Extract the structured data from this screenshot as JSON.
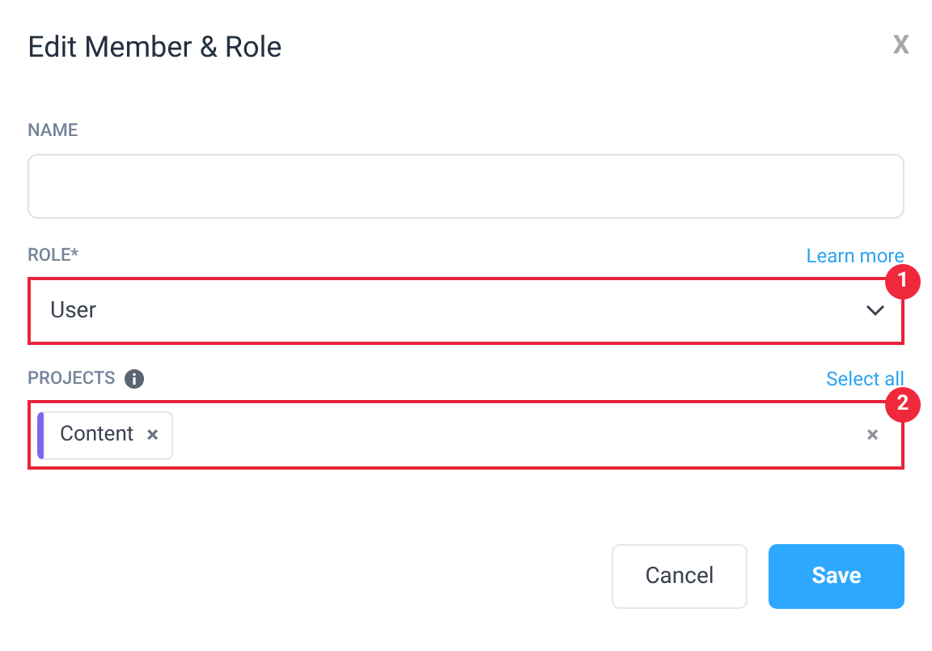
{
  "dialog": {
    "title": "Edit Member & Role",
    "close": "X"
  },
  "name_field": {
    "label": "NAME"
  },
  "role_field": {
    "label": "ROLE*",
    "link": "Learn more",
    "value": "User",
    "annotation": "1"
  },
  "projects_field": {
    "label": "PROJECTS",
    "link": "Select all",
    "annotation": "2",
    "tags": [
      {
        "label": "Content",
        "remove": "×",
        "color": "#7b68ee"
      }
    ],
    "clear": "×"
  },
  "buttons": [
    {
      "label": "Cancel",
      "kind": "secondary"
    },
    {
      "label": "Save",
      "kind": "primary"
    }
  ]
}
